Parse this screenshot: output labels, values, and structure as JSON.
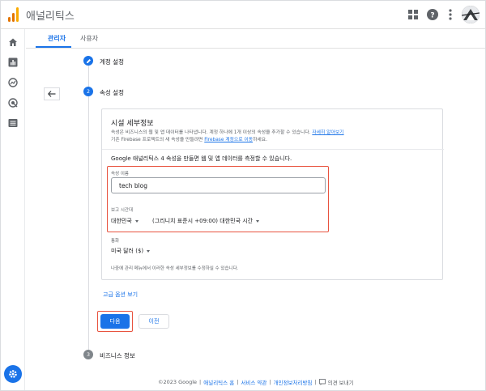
{
  "app": {
    "title": "애널리틱스"
  },
  "tabs": [
    {
      "label": "관리자",
      "active": true
    },
    {
      "label": "사용자",
      "active": false
    }
  ],
  "steps": [
    {
      "number": "",
      "label": "계정 설정",
      "state": "completed"
    },
    {
      "number": "2",
      "label": "속성 설정",
      "state": "active"
    },
    {
      "number": "3",
      "label": "비즈니스 정보",
      "state": "pending"
    }
  ],
  "card": {
    "title": "시설 세부정보",
    "desc_line1": "속성은 비즈니스의 웹 및 앱 데이터를 나타냅니다. 계정 하나에 1개 이상의 속성을 추가할 수 있습니다.",
    "desc_line1_link": "자세히 알아보기",
    "desc_line2_prefix": "기존 Firebase 프로젝트의 새 속성을 만들려면",
    "desc_line2_link": "Firebase 계정으로 이동",
    "desc_line2_suffix": "하세요.",
    "headline": "Google 애널리틱스 4 속성을 만들면 웹 및 앱 데이터를 측정할 수 있습니다.",
    "property_name_label": "속성 이름",
    "property_name_value": "tech blog",
    "timezone_label": "보고 시간대",
    "timezone_country": "대한민국",
    "timezone_value": "(그리니치 표준시 +09:00) 대한민국 시간",
    "currency_label": "통화",
    "currency_value": "미국 달러 ($)",
    "note": "나중에 관리 메뉴에서 이러한 속성 세부정보를 수정하실 수 있습니다."
  },
  "advanced_link": "고급 옵션 보기",
  "buttons": {
    "next": "다음",
    "prev": "이전"
  },
  "footer": {
    "copyright": "©2023 Google",
    "link1": "애널리틱스 홈",
    "link2": "서비스 약관",
    "link3": "개인정보처리방침",
    "feedback": "의견 보내기"
  },
  "colors": {
    "accent": "#1a73e8",
    "highlight": "#e8533f",
    "logo_orange": "#f9ab00",
    "logo_dark": "#e37400"
  },
  "icons": [
    "apps-grid-icon",
    "help-icon",
    "more-vert-icon",
    "home-icon",
    "reports-icon",
    "explore-icon",
    "advertising-icon",
    "configure-icon",
    "admin-settings-icon",
    "back-arrow-icon",
    "edit-pencil-icon",
    "feedback-icon"
  ]
}
